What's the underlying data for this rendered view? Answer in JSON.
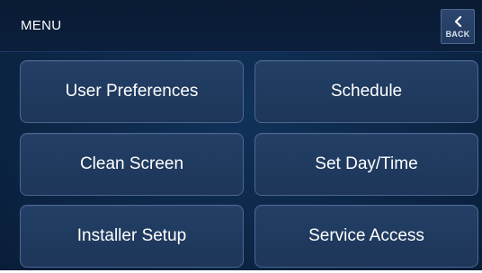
{
  "header": {
    "title": "MENU",
    "back_label": "BACK"
  },
  "menu": {
    "buttons": [
      {
        "label": "User Preferences"
      },
      {
        "label": "Schedule"
      },
      {
        "label": "Clean Screen"
      },
      {
        "label": "Set Day/Time"
      },
      {
        "label": "Installer Setup"
      },
      {
        "label": "Service Access"
      }
    ]
  },
  "colors": {
    "background": "#0c2748",
    "header_background": "#0b1f3c",
    "button_fill": "#233f66",
    "button_border": "#4b6790",
    "text": "#ffffff"
  },
  "icons": {
    "back": "chevron-left-icon"
  }
}
